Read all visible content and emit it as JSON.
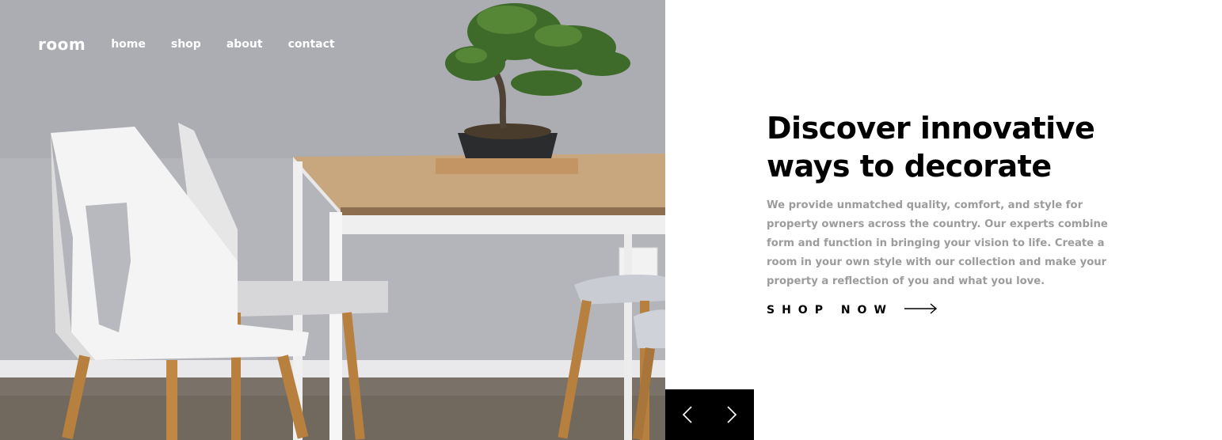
{
  "brand": {
    "logo": "room"
  },
  "nav": {
    "items": [
      {
        "label": "home"
      },
      {
        "label": "shop"
      },
      {
        "label": "about"
      },
      {
        "label": "contact"
      }
    ]
  },
  "hero": {
    "image_icon": "furniture-photo",
    "headline": "Discover innovative ways to decorate",
    "body": "We provide unmatched quality, comfort, and style for property owners across the country. Our experts combine form and function in bringing your vision to life. Create a room in your own style with our collection and make your property a reflection of you and what you love.",
    "cta_label": "SHOP NOW",
    "cta_icon": "arrow-right-icon"
  },
  "slider": {
    "prev_icon": "angle-left-icon",
    "next_icon": "angle-right-icon"
  },
  "colors": {
    "accent": "#000000",
    "text_muted": "#9c9c9c",
    "nav_text": "#ffffff"
  }
}
